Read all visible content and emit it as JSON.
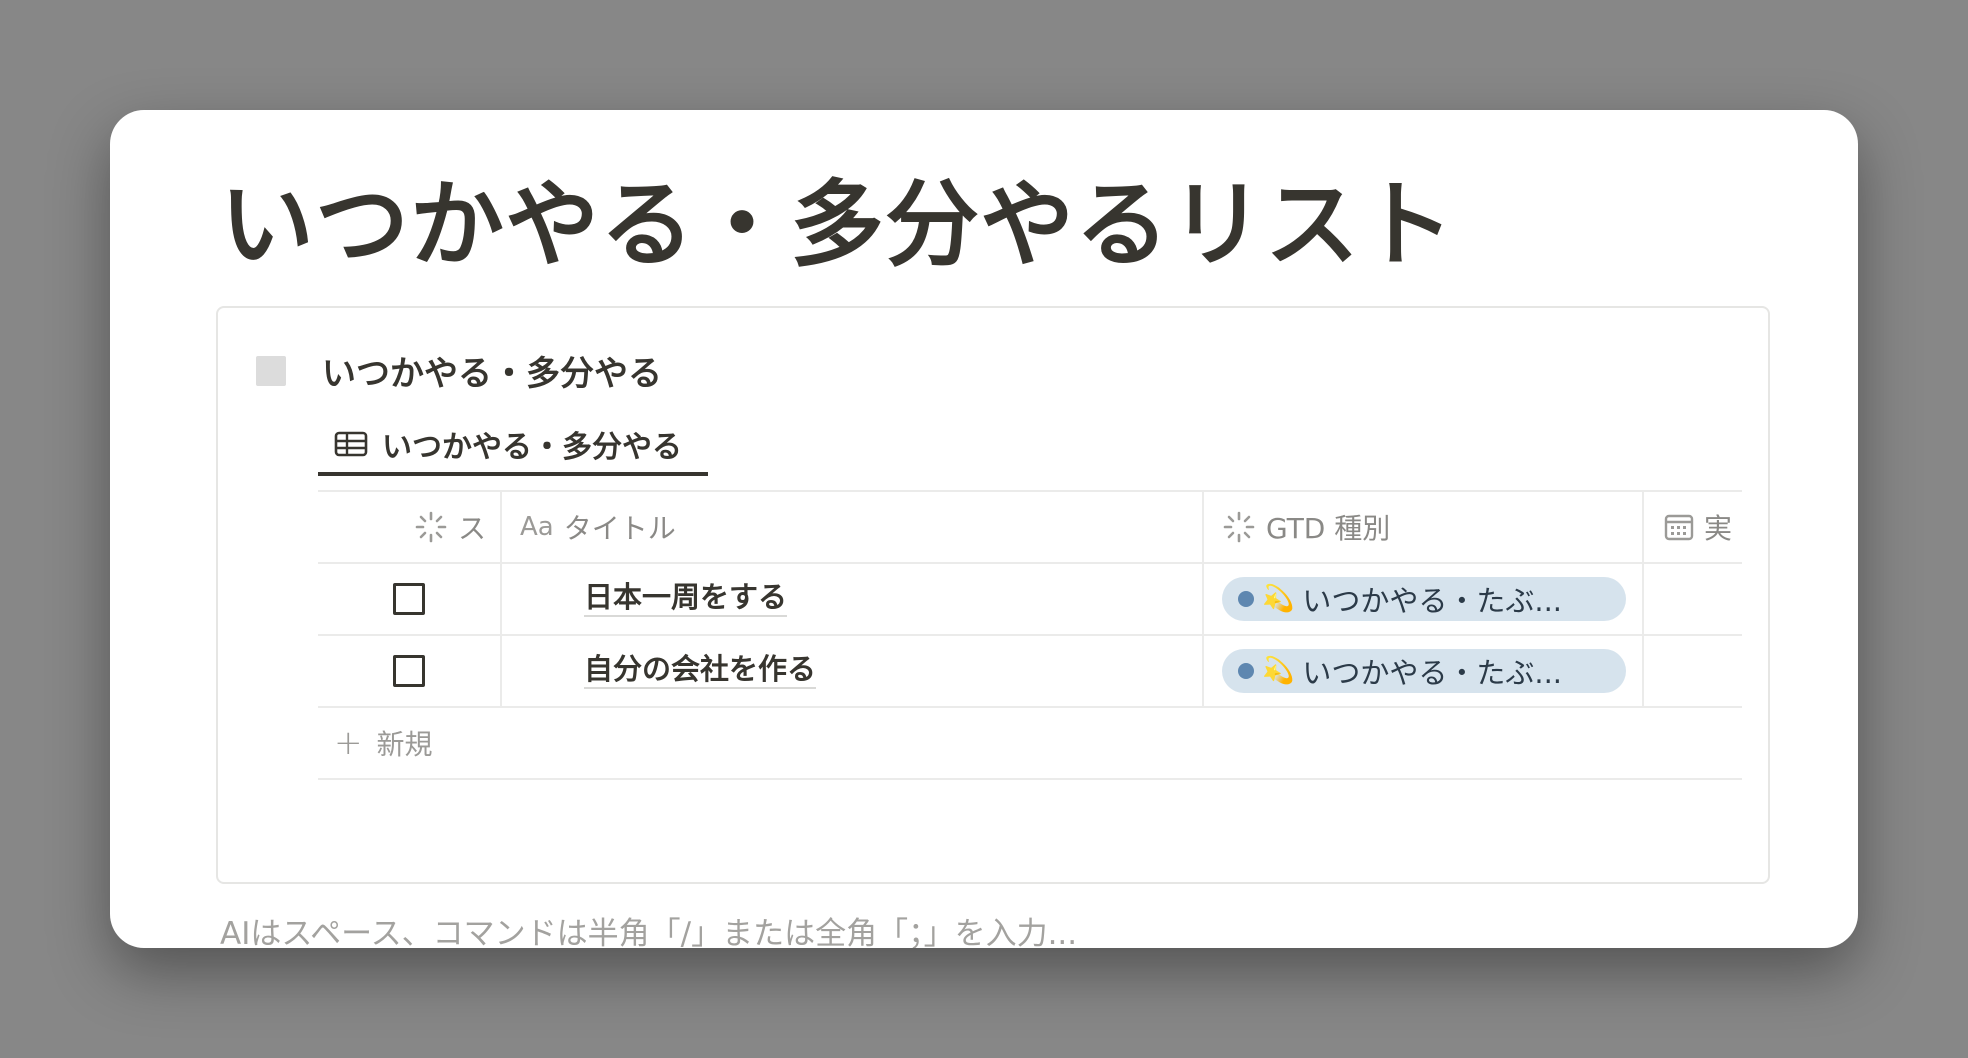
{
  "page": {
    "title": "いつかやる・多分やるリスト"
  },
  "database": {
    "title": "いつかやる・多分やる",
    "view_tab": {
      "icon": "table-icon",
      "label": "いつかやる・多分やる"
    },
    "columns": [
      {
        "icon": "status-icon",
        "label": "ス"
      },
      {
        "icon": "title-aa-icon",
        "icon_text": "Aa",
        "label": "タイトル"
      },
      {
        "icon": "status-icon",
        "label": "GTD 種別"
      },
      {
        "icon": "calendar-icon",
        "label": "実"
      }
    ],
    "rows": [
      {
        "checked": false,
        "title": "日本一周をする",
        "gtd_tag": {
          "emoji": "💫",
          "label": "いつかやる・たぶ..."
        }
      },
      {
        "checked": false,
        "title": "自分の会社を作る",
        "gtd_tag": {
          "emoji": "💫",
          "label": "いつかやる・たぶ..."
        }
      }
    ],
    "new_row": {
      "icon": "plus-icon",
      "label": "新規"
    }
  },
  "editor": {
    "placeholder": "AIはスペース、コマンドは半角「/」または全角「；」を入力..."
  },
  "colors": {
    "text": "#37352f",
    "muted": "#8a8986",
    "tag_bg": "#d6e3ed",
    "tag_dot": "#5e87b0",
    "backdrop": "#878787"
  }
}
